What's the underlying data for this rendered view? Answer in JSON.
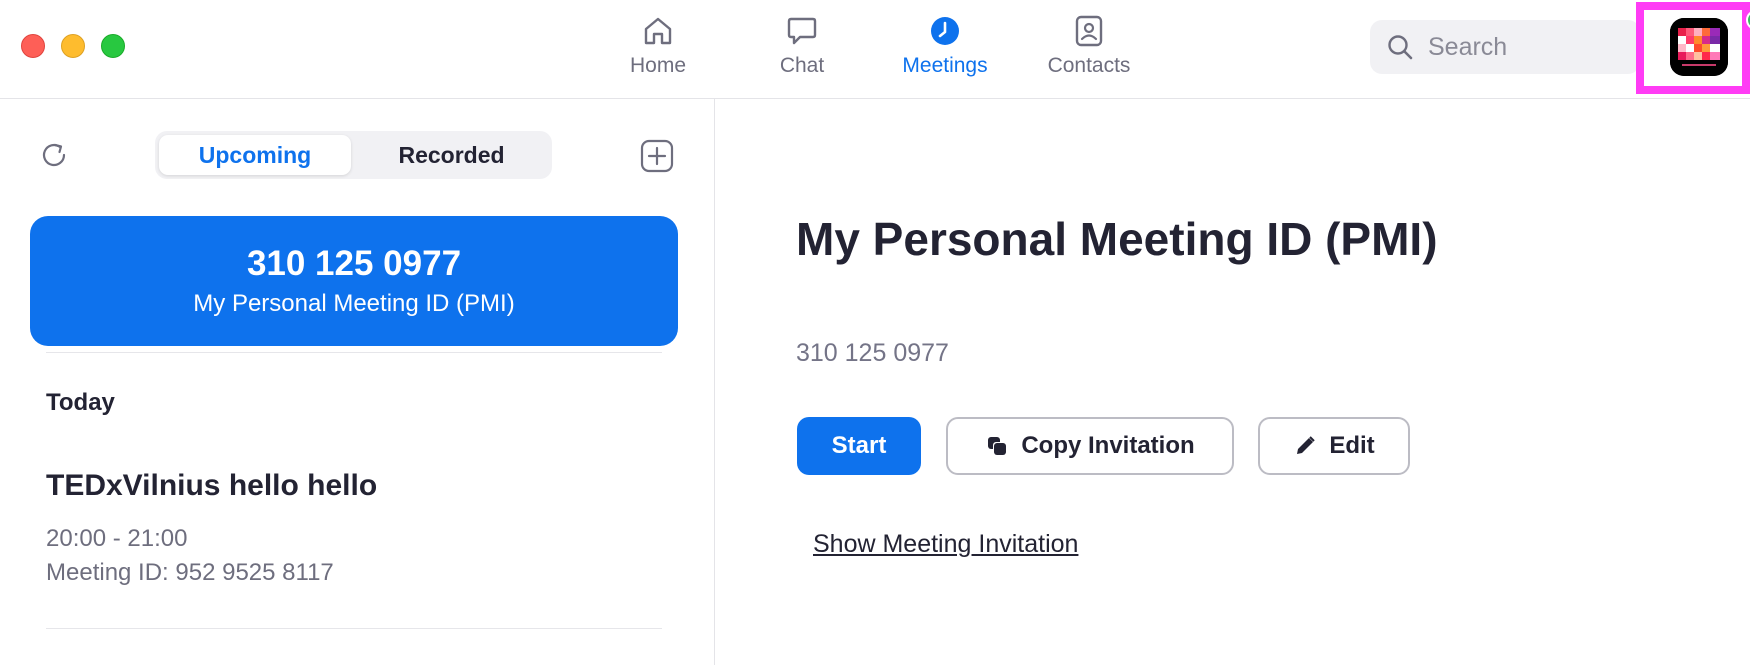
{
  "window": {
    "controls": [
      "close",
      "minimize",
      "maximize"
    ]
  },
  "nav": {
    "items": [
      {
        "label": "Home",
        "icon": "home-icon",
        "active": false
      },
      {
        "label": "Chat",
        "icon": "chat-icon",
        "active": false
      },
      {
        "label": "Meetings",
        "icon": "clock-icon",
        "active": true
      },
      {
        "label": "Contacts",
        "icon": "contacts-icon",
        "active": false
      }
    ],
    "search_placeholder": "Search"
  },
  "sidebar": {
    "tabs": {
      "upcoming": "Upcoming",
      "recorded": "Recorded"
    },
    "pmi_card": {
      "number": "310 125 0977",
      "label": "My Personal Meeting ID (PMI)"
    },
    "section_today": "Today",
    "meeting": {
      "title": "TEDxVilnius hello hello",
      "time": "20:00 - 21:00",
      "meeting_id": "Meeting ID: 952 9525 8117"
    }
  },
  "detail": {
    "title": "My Personal Meeting ID (PMI)",
    "number": "310 125 0977",
    "start_label": "Start",
    "copy_label": "Copy Invitation",
    "edit_label": "Edit",
    "show_invite_label": "Show Meeting Invitation"
  },
  "colors": {
    "accent": "#0e72ed",
    "avatar_highlight": "#ff3cf5",
    "online": "#3ac05f"
  }
}
